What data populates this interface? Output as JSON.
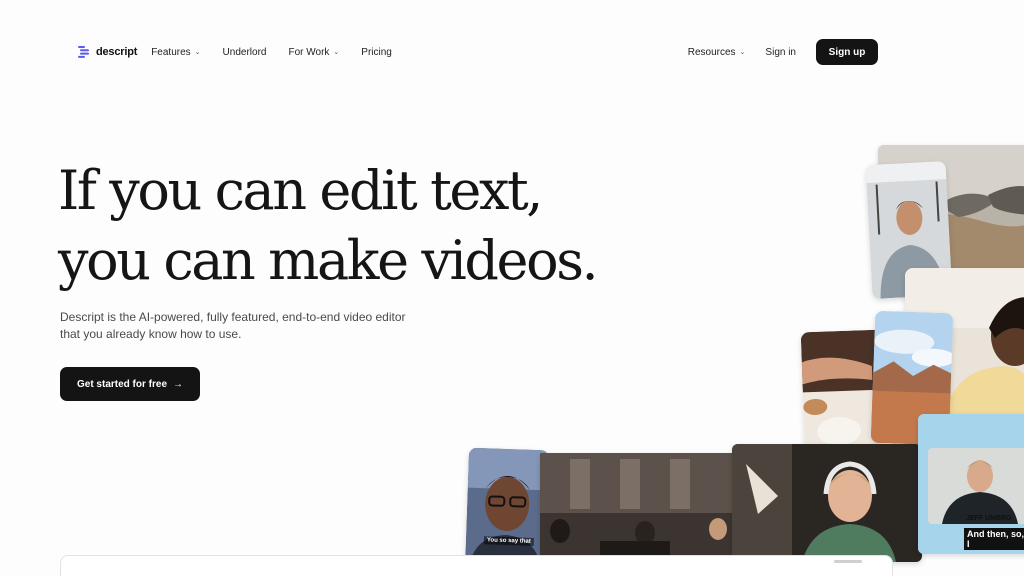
{
  "brand": {
    "name": "descript",
    "logo_icon": "descript-logo-icon",
    "accent": "#5b5bf0"
  },
  "nav": {
    "links": [
      {
        "label": "Features",
        "has_dropdown": true
      },
      {
        "label": "Underlord",
        "has_dropdown": false
      },
      {
        "label": "For Work",
        "has_dropdown": true
      },
      {
        "label": "Pricing",
        "has_dropdown": false
      }
    ],
    "right_links": [
      {
        "label": "Resources",
        "has_dropdown": true
      },
      {
        "label": "Sign in",
        "has_dropdown": false
      }
    ],
    "signup_label": "Sign up",
    "dropdown_icon": "chevron-down-icon"
  },
  "hero": {
    "title_line1": "If you can edit text,",
    "title_line2": "you can make videos.",
    "subtitle_line1": "Descript is the AI-powered, fully featured, end-to-end video editor",
    "subtitle_line2": "that you already know how to use.",
    "cta_label": "Get started for free",
    "cta_icon": "arrow-right-icon"
  },
  "collage": {
    "caption_small": "You so say that",
    "name_tag": "JEFF UMBRO",
    "caption_large": "And then, so, I"
  },
  "colors": {
    "button_bg": "#141414",
    "text": "#151515",
    "muted": "#4a4a4a"
  }
}
